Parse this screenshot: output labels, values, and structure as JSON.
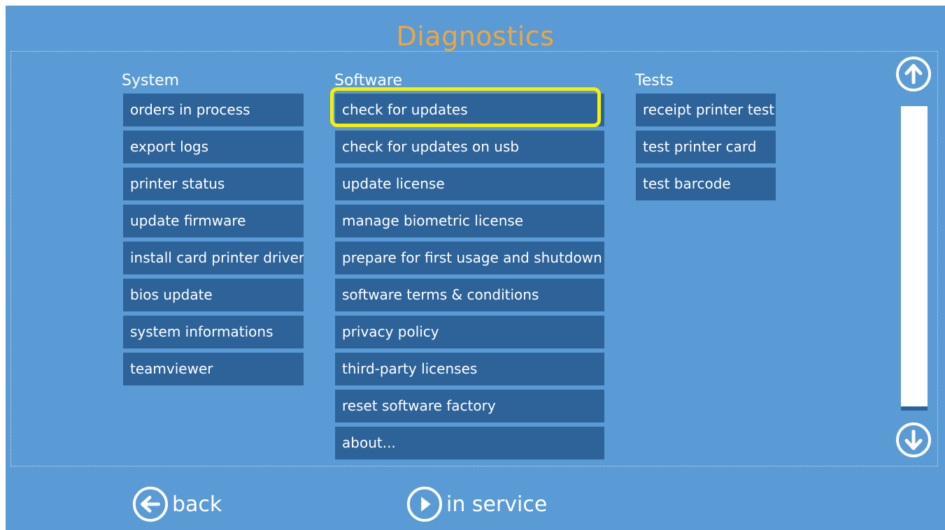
{
  "title": "Diagnostics",
  "columns": {
    "system": {
      "heading": "System",
      "items": [
        "orders in process",
        "export logs",
        "printer status",
        "update firmware",
        "install card printer driver",
        "bios update",
        "system informations",
        "teamviewer"
      ]
    },
    "software": {
      "heading": "Software",
      "items": [
        "check for updates",
        "check for updates on usb",
        "update license",
        "manage biometric license",
        "prepare for first usage and shutdown",
        "software terms & conditions",
        "privacy policy",
        "third-party licenses",
        "reset software factory",
        "about..."
      ]
    },
    "tests": {
      "heading": "Tests",
      "items": [
        "receipt printer test",
        "test printer card",
        "test barcode"
      ]
    }
  },
  "scroll": {
    "up_icon": "arrow-up-circle-icon",
    "down_icon": "arrow-down-circle-icon",
    "position": 1.0
  },
  "footer": {
    "back_label": "back",
    "back_icon": "arrow-left-circle-icon",
    "service_label": "in service",
    "service_icon": "play-circle-icon"
  },
  "colors": {
    "background": "#5b9bd5",
    "button": "#2e6399",
    "title": "#f0a63a",
    "highlight": "#f8f000"
  }
}
